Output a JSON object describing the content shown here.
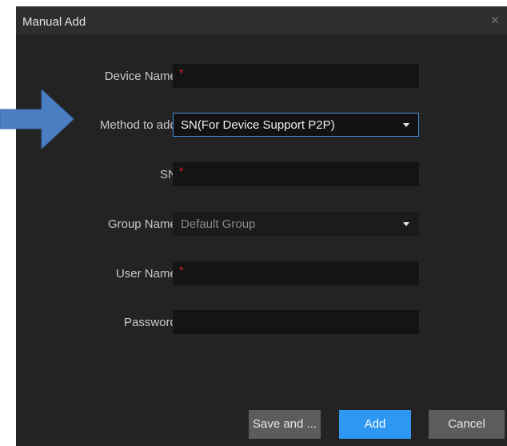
{
  "dialog": {
    "title": "Manual Add",
    "close_icon": "×"
  },
  "form": {
    "device_name": {
      "label": "Device Name:",
      "value": "",
      "required_mark": "*"
    },
    "method": {
      "label": "Method to add:",
      "selected": "SN(For Device Support P2P)"
    },
    "sn": {
      "label": "SN:",
      "value": "",
      "required_mark": "*"
    },
    "group": {
      "label": "Group Name:",
      "selected": "Default Group"
    },
    "user_name": {
      "label": "User Name:",
      "value": "",
      "required_mark": "*"
    },
    "password": {
      "label": "Password:",
      "value": ""
    }
  },
  "buttons": {
    "save": "Save and ...",
    "add": "Add",
    "cancel": "Cancel"
  },
  "colors": {
    "dialog_bg": "#232323",
    "accent": "#2e97f2",
    "required": "#d8242a",
    "pointer_arrow": "#4a7fc4"
  },
  "icons": {
    "pointer": "arrow-right-icon",
    "dropdown": "caret-down-icon",
    "close": "close-icon"
  }
}
